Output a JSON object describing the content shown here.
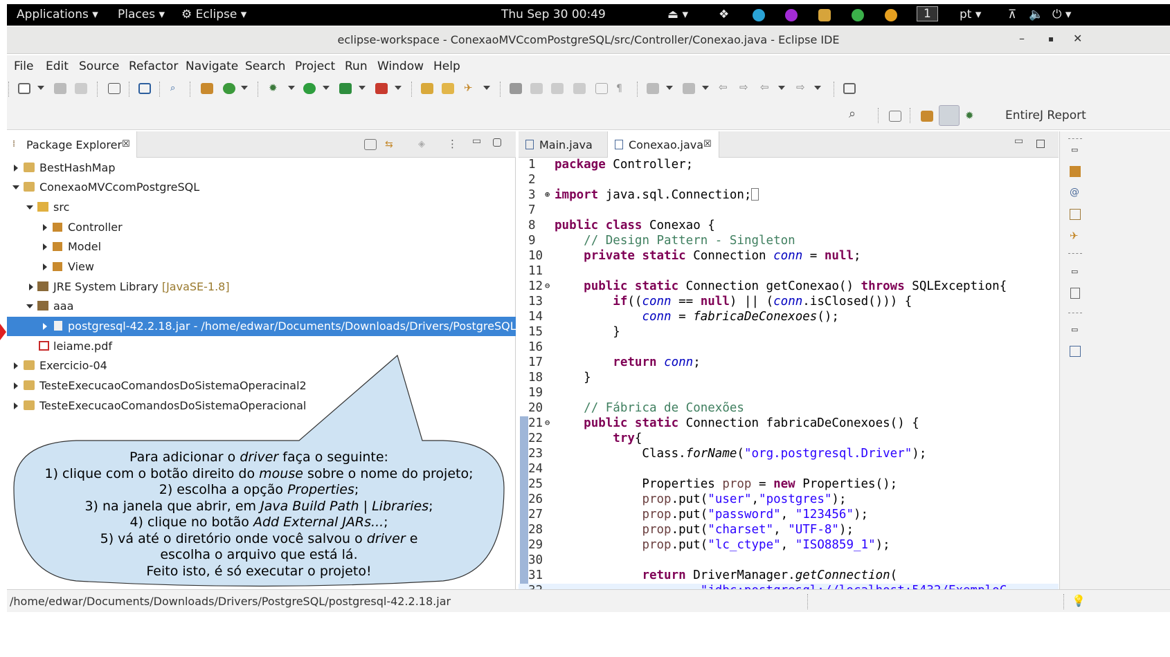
{
  "topbar": {
    "applications": "Applications ▾",
    "places": "Places ▾",
    "eclipse": "Eclipse ▾",
    "clock": "Thu Sep 30  00:49",
    "workspace_num": "1",
    "lang": "pt ▾"
  },
  "window": {
    "title": "eclipse-workspace - ConexaoMVCcomPostgreSQL/src/Controller/Conexao.java - Eclipse IDE"
  },
  "menu": [
    "File",
    "Edit",
    "Source",
    "Refactor",
    "Navigate",
    "Search",
    "Project",
    "Run",
    "Window",
    "Help"
  ],
  "toolbar2": {
    "right_label": "EntireJ Report"
  },
  "package_explorer": {
    "title": "Package Explorer",
    "tree": [
      {
        "label": "BestHashMap",
        "decor": ""
      },
      {
        "label": "ConexaoMVCcomPostgreSQL",
        "decor": ""
      },
      {
        "label": "src",
        "decor": ""
      },
      {
        "label": "Controller",
        "decor": ""
      },
      {
        "label": "Model",
        "decor": ""
      },
      {
        "label": "View",
        "decor": ""
      },
      {
        "label": "JRE System Library",
        "decor": "[JavaSE-1.8]"
      },
      {
        "label": "aaa",
        "decor": ""
      },
      {
        "label": "postgresql-42.2.18.jar - /home/edwar/Documents/Downloads/Drivers/PostgreSQL",
        "decor": ""
      },
      {
        "label": "leiame.pdf",
        "decor": ""
      },
      {
        "label": "Exercicio-04",
        "decor": ""
      },
      {
        "label": "TesteExecucaoComandosDoSistemaOperacinal2",
        "decor": ""
      },
      {
        "label": "TesteExecucaoComandosDoSistemaOperacional",
        "decor": ""
      }
    ]
  },
  "editor": {
    "tabs": [
      "Main.java",
      "Conexao.java"
    ],
    "line_numbers": [
      "1",
      "2",
      "3",
      "7",
      "8",
      "9",
      "10",
      "11",
      "12",
      "13",
      "14",
      "15",
      "16",
      "17",
      "18",
      "19",
      "20",
      "21",
      "22",
      "23",
      "24",
      "25",
      "26",
      "27",
      "28",
      "29",
      "30",
      "31",
      "32"
    ]
  },
  "callout": {
    "lines": [
      [
        "Para adicionar o ",
        "driver",
        " faça o seguinte:"
      ],
      [
        "1) clique com o botão direito do ",
        "mouse",
        " sobre o nome do projeto;"
      ],
      [
        "2) escolha a opção ",
        "Properties",
        ";"
      ],
      [
        "3) na janela que abrir, em ",
        "Java Build Path | Libraries",
        ";"
      ],
      [
        "4) clique no botão ",
        "Add External JARs...",
        ";"
      ],
      [
        "5) vá até o diretório onde você salvou o ",
        "driver",
        " e"
      ],
      [
        "escolha o arquivo que está lá.",
        "",
        ""
      ],
      [
        "Feito isto, é só executar o projeto!",
        "",
        ""
      ]
    ]
  },
  "status": {
    "path": "/home/edwar/Documents/Downloads/Drivers/PostgreSQL/postgresql-42.2.18.jar"
  },
  "colors": {
    "selection": "#3b85d6",
    "callout_fill": "#cfe3f3",
    "keyword": "#7f0055",
    "comment": "#3f7f5f",
    "string": "#2a00ff"
  }
}
